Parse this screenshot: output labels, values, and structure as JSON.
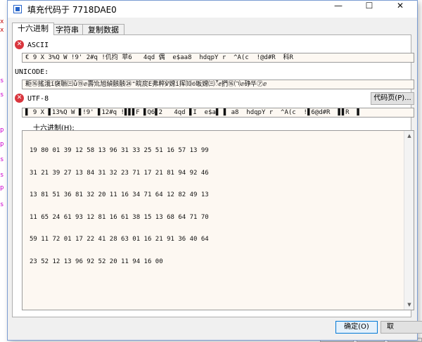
{
  "background": {
    "left_chars": [
      {
        "text": "x",
        "color": "#c00000"
      },
      {
        "text": "x",
        "color": "#c00000"
      },
      {
        "text": "s",
        "color": "#cc00cc"
      },
      {
        "text": "s",
        "color": "#cc00cc"
      },
      {
        "text": "p",
        "color": "#cc00cc"
      },
      {
        "text": "p",
        "color": "#cc00cc"
      },
      {
        "text": "s",
        "color": "#cc00cc"
      },
      {
        "text": "s",
        "color": "#cc00cc"
      },
      {
        "text": "p",
        "color": "#cc00cc"
      },
      {
        "text": "s",
        "color": "#cc00cc"
      }
    ]
  },
  "window": {
    "title": "填充代码于 7718DAE0",
    "minimize": "—",
    "maximize": "☐",
    "close": "✕"
  },
  "tabs": [
    {
      "label": "十六进制",
      "active": true
    },
    {
      "label": "字符串",
      "active": false
    },
    {
      "label": "复制数据",
      "active": false
    }
  ],
  "sections": {
    "ascii": {
      "label": "ASCII",
      "value": "€ 9 X 3%Q W !9' 2#q !仉抣 苹6   4qd 偶  e$aa8  hdqpY r  ^A(c  !@d#R  科R"
    },
    "unicode": {
      "label": "UNICODE:",
      "value": "耟⑯搖涐ǐ襃聮㈢ǚ⑲ⅇ壽㠩旭緽骸骸㉔⁼皖扊Ε弗粹℣嫦ǐ挥⑽⟃昄嫦㈢ॕⅇ捫⑯㈀ⅇ碀뚜㋐ⅇ"
    },
    "utf8": {
      "label": "UTF-8",
      "value": "▋ 9 X ▋13%Q W ▋!9' ▋12#q !▋▋▋F ▋Q6▋2   4qd ▋I  e$a▋ ▋ a8  hdqpY r  ^A(c  !▋6@d#R  ▋▋R  ▋"
    }
  },
  "codepage_button": "代码页(P)...",
  "hex_label": "十六进制(H):",
  "hex_lines": [
    "19 80 01 39 12 58 13 96 31 33 25 51 16 57 13 99",
    "31 21 39 27 13 84 31 32 23 71 17 21 81 94 92 46",
    "13 81 51 36 81 32 20 11 16 34 71 64 12 82 49 13",
    "11 65 24 61 93 12 81 16 61 38 15 13 68 64 71 70",
    "59 11 72 01 17 22 41 28 63 01 16 21 91 36 40 64",
    "23 52 12 13 96 92 52 20 11 94 16 00"
  ],
  "buttons": {
    "ok": "确定(O)",
    "cancel": "取"
  }
}
